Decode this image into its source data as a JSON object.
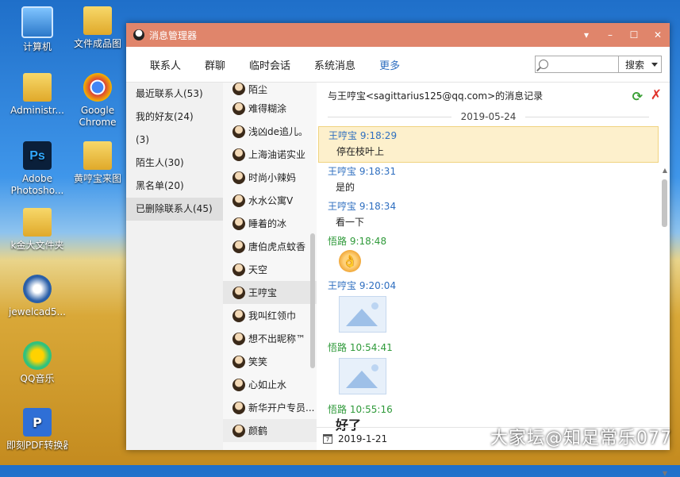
{
  "desktop": {
    "icons": [
      {
        "label": "计算机",
        "icon": "computer-icon"
      },
      {
        "label": "文件成品图",
        "icon": "folder-icon"
      },
      {
        "label": "Administr...",
        "icon": "folder-user-icon"
      },
      {
        "label": "Google Chrome",
        "icon": "chrome-icon"
      },
      {
        "label": "Adobe Photosho...",
        "icon": "photoshop-icon"
      },
      {
        "label": "黄哼宝来图",
        "icon": "folder-icon"
      },
      {
        "label": "k金大文件夹",
        "icon": "folder-icon"
      },
      {
        "label": "jewelcad5...",
        "icon": "jewelcad-icon"
      },
      {
        "label": "QQ音乐",
        "icon": "qqmusic-icon"
      },
      {
        "label": "即刻PDF转换器",
        "icon": "pdf-icon"
      }
    ],
    "ps_glyph": "Ps",
    "pdf_glyph": "P",
    "watermark": "大家坛@知足常乐077"
  },
  "window": {
    "title": "消息管理器",
    "controls": {
      "menu": "▾",
      "minimize": "–",
      "maximize": "☐",
      "close": "✕"
    }
  },
  "toolbar": {
    "tabs": [
      "联系人",
      "群聊",
      "临时会话",
      "系统消息",
      "更多"
    ],
    "search": {
      "placeholder": "",
      "button": "搜索"
    }
  },
  "groups": [
    {
      "label": "最近联系人(53)"
    },
    {
      "label": "我的好友(24)"
    },
    {
      "label": "(3)"
    },
    {
      "label": "陌生人(30)"
    },
    {
      "label": "黑名单(20)"
    },
    {
      "label": "已删除联系人(45)"
    }
  ],
  "contacts": [
    "陌尘",
    "难得糊涂",
    "浅凶de追儿。",
    "上海油诺实业",
    "时尚小辣妈",
    "水水公寓V",
    "睡着的冰",
    "唐伯虎点蚊香",
    "天空",
    "王哼宝",
    "我叫红领巾",
    "想不出昵称™",
    "笑笑",
    "心如止水",
    "新华开户专员...",
    "颜鹤"
  ],
  "main": {
    "header": "与王哼宝<sagittarius125@qq.com>的消息记录",
    "date": "2019-05-24",
    "messages": [
      {
        "sender": "王哼宝 9:18:29",
        "type": "text",
        "text": "停在枝叶上",
        "color": "#2f6fc0",
        "highlight": true
      },
      {
        "sender": "王哼宝 9:18:31",
        "type": "text",
        "text": "是的",
        "color": "#2f6fc0"
      },
      {
        "sender": "王哼宝 9:18:34",
        "type": "text",
        "text": "看一下",
        "color": "#2f6fc0"
      },
      {
        "sender": "悟路 9:18:48",
        "type": "emoji",
        "icon": "ok-hand-emoji-icon",
        "color": "#2f9a3a"
      },
      {
        "sender": "王哼宝 9:20:04",
        "type": "image",
        "icon": "image-placeholder-icon",
        "color": "#2f6fc0"
      },
      {
        "sender": "悟路 10:54:41",
        "type": "image",
        "icon": "image-placeholder-icon",
        "color": "#2f9a3a"
      },
      {
        "sender": "悟路 10:55:16",
        "type": "text",
        "text": "好了",
        "color": "#2f9a3a",
        "big": true
      }
    ],
    "bottom_date": "2019-1-21",
    "calendar_glyph": "7"
  }
}
